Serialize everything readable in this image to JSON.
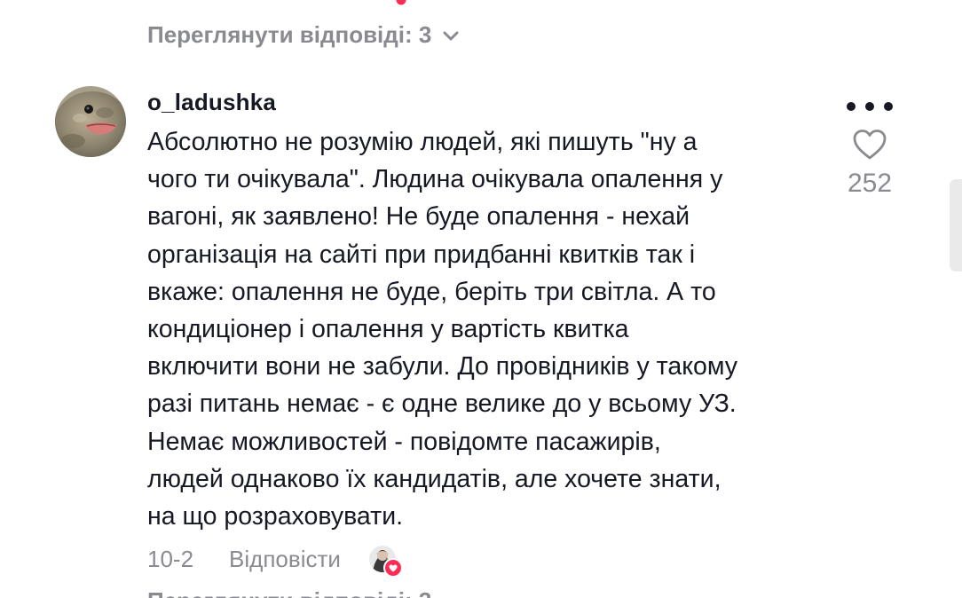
{
  "thread": {
    "view_replies_label": "Переглянути відповіді: 3"
  },
  "comment": {
    "username": "o_ladushka",
    "text_lines": [
      "Абсолютно не розумію людей, які пишуть \"ну а",
      "чого ти очікувала\". Людина очікувала опалення у",
      "вагоні, як заявлено! Не буде опалення - нехай",
      "організація на сайті при придбанні квитків так і",
      "вкаже: опалення не буде, беріть три світла. А то",
      "кондиціонер і опалення у вартість квитка",
      "включити вони не забули. До провідників у такому",
      "разі питань немає - є одне велике до у всьому УЗ.",
      "Немає можливостей - повідомте пасажирів,",
      "людей однаково їх кандидатів, але хочете знати,",
      "на що розраховувати."
    ],
    "like_count": "252",
    "date": "10-2",
    "reply_label": "Відповісти"
  },
  "icons": {
    "more": "more-horizontal-icon",
    "like": "heart-outline-icon",
    "chevron": "chevron-down-icon",
    "liked_badge": "heart-filled-icon"
  },
  "colors": {
    "primary_text": "#161823",
    "secondary_text": "#8a8b91",
    "accent": "#fe2c55"
  }
}
